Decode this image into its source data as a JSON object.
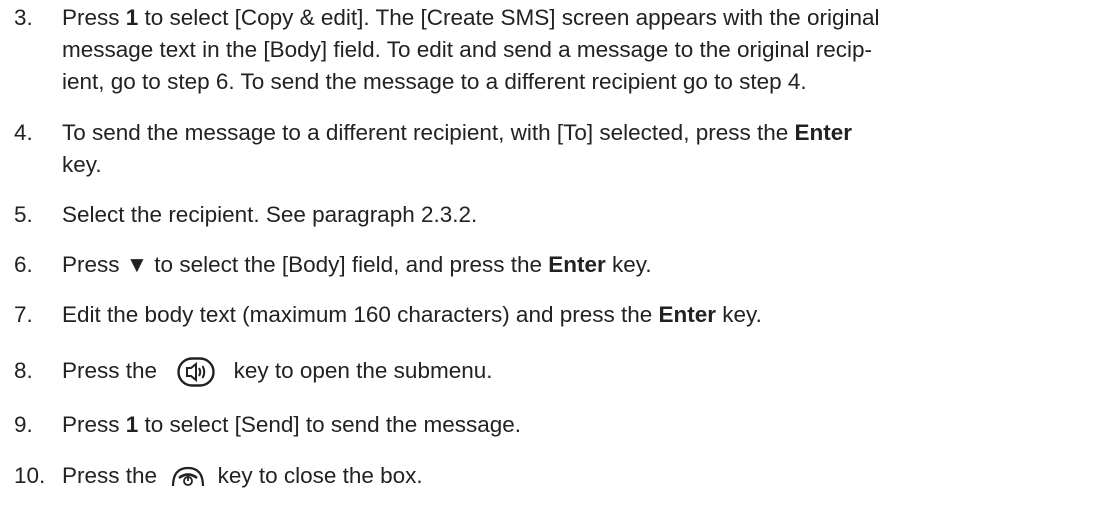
{
  "steps": [
    {
      "number": "3.",
      "lines": [
        [
          "Press ",
          "1",
          " to select [Copy & edit]. The [Create SMS] screen appears with the original"
        ],
        [
          "message text in the [Body] field. To edit and send a message to the original recip-"
        ],
        [
          "ient, go to step 6. To send the message to a different recipient go to step 4."
        ]
      ]
    },
    {
      "number": "4.",
      "lines": [
        [
          "To send the message to a different recipient, with [To] selected, press the ",
          "Enter"
        ],
        [
          "key."
        ]
      ]
    },
    {
      "number": "5.",
      "lines": [
        [
          "Select the recipient. See paragraph 2.3.2."
        ]
      ]
    },
    {
      "number": "6.",
      "parts": [
        "Press ",
        "▼",
        " to select the [Body] field, and press the ",
        "Enter",
        " key."
      ]
    },
    {
      "number": "7.",
      "parts": [
        "Edit the body text (maximum 160 characters) and press the ",
        "Enter",
        " key."
      ]
    },
    {
      "number": "8.",
      "parts": [
        "Press the",
        " key to open the submenu."
      ],
      "icon": "speaker-key-icon"
    },
    {
      "number": "9.",
      "parts": [
        "Press ",
        "1",
        " to select [Send] to send the message."
      ]
    },
    {
      "number": "10.",
      "parts": [
        "Press the",
        " key to close the box."
      ],
      "icon": "end-call-key-icon"
    }
  ]
}
